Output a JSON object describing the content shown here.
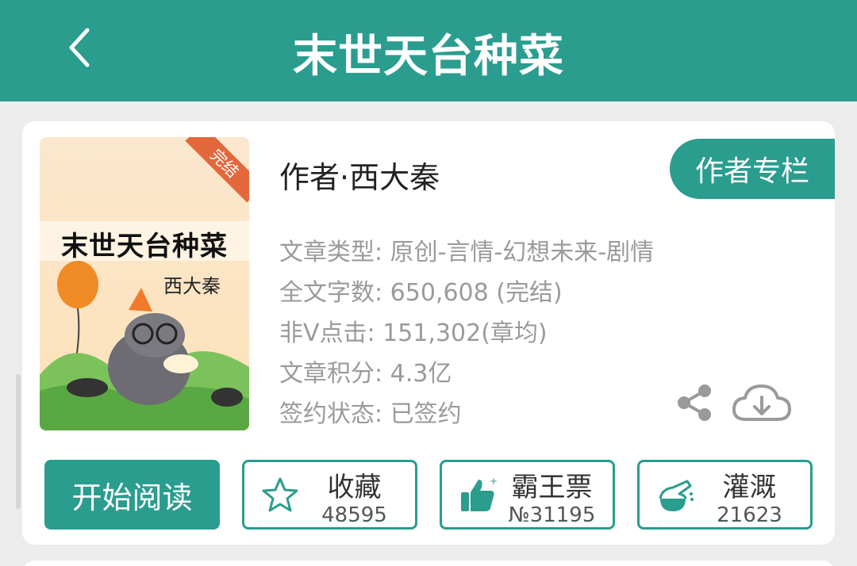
{
  "header": {
    "title": "末世天台种菜",
    "back_icon": "back-arrow-icon"
  },
  "cover": {
    "title": "末世天台种菜",
    "author": "西大秦",
    "ribbon": "完结"
  },
  "book": {
    "author_line": "作者·西大秦",
    "column_button": "作者专栏",
    "meta": [
      "文章类型: 原创-言情-幻想未来-剧情",
      "全文字数: 650,608 (完结)",
      "非Ⅴ点击: 151,302(章均)",
      "文章积分: 4.3亿",
      "签约状态:  已签约"
    ]
  },
  "actions": {
    "read_button": "开始阅读",
    "favorite": {
      "label": "收藏",
      "count": "48595",
      "icon": "star-icon"
    },
    "vote": {
      "label": "霸王票",
      "count": "№31195",
      "icon": "thumbs-up-icon"
    },
    "water": {
      "label": "灌溉",
      "count": "21623",
      "icon": "flask-icon"
    }
  },
  "colors": {
    "brand": "#2a9d8f",
    "ribbon": "#e2683c"
  }
}
